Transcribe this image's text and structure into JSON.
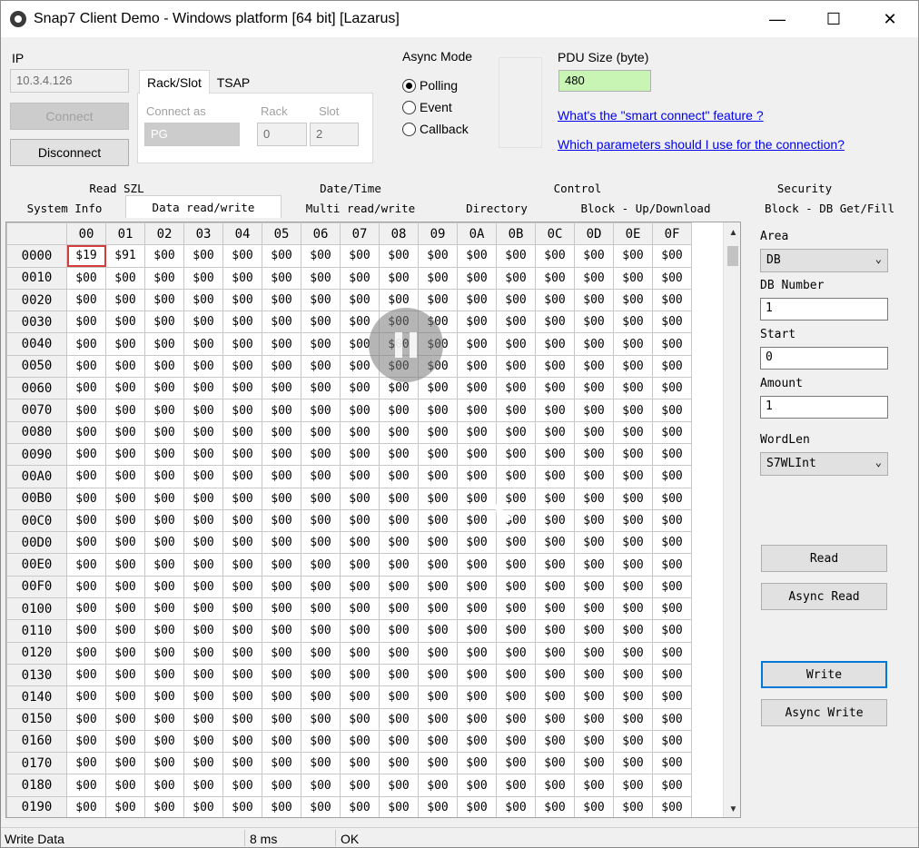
{
  "window": {
    "title": "Snap7 Client Demo - Windows platform [64 bit] [Lazarus]",
    "minimize": "—",
    "maximize": "☐",
    "close": "✕"
  },
  "connection": {
    "ip_label": "IP",
    "ip_value": "10.3.4.126",
    "connect_label": "Connect",
    "disconnect_label": "Disconnect",
    "tab_rack_slot": "Rack/Slot",
    "tab_tsap": "TSAP",
    "connect_as_label": "Connect as",
    "connect_as_value": "PG",
    "rack_label": "Rack",
    "rack_value": "0",
    "slot_label": "Slot",
    "slot_value": "2"
  },
  "async": {
    "label": "Async Mode",
    "options": [
      {
        "label": "Polling",
        "checked": true
      },
      {
        "label": "Event",
        "checked": false
      },
      {
        "label": "Callback",
        "checked": false
      }
    ]
  },
  "pdu": {
    "label": "PDU Size (byte)",
    "value": "480",
    "link1": "What's the \"smart connect\" feature ?",
    "link2": "Which parameters should I use for the connection?"
  },
  "tabs_top": [
    "Read SZL",
    "Date/Time",
    "Control",
    "Security"
  ],
  "tabs_bottom": [
    "System Info",
    "Data read/write",
    "Multi read/write",
    "Directory",
    "Block - Up/Download",
    "Block - DB Get/Fill"
  ],
  "active_tab": "Data read/write",
  "grid": {
    "columns": [
      "00",
      "01",
      "02",
      "03",
      "04",
      "05",
      "06",
      "07",
      "08",
      "09",
      "0A",
      "0B",
      "0C",
      "0D",
      "0E",
      "0F"
    ],
    "rows": [
      "0000",
      "0010",
      "0020",
      "0030",
      "0040",
      "0050",
      "0060",
      "0070",
      "0080",
      "0090",
      "00A0",
      "00B0",
      "00C0",
      "00D0",
      "00E0",
      "00F0",
      "0100",
      "0110",
      "0120",
      "0130",
      "0140",
      "0150",
      "0160",
      "0170",
      "0180",
      "0190"
    ],
    "default_value": "$00",
    "first_row_values": [
      "$19",
      "$91",
      "$00",
      "$00",
      "$00",
      "$00",
      "$00",
      "$00",
      "$00",
      "$00",
      "$00",
      "$00",
      "$00",
      "$00",
      "$00",
      "$00"
    ],
    "other_values": "$00",
    "selected_cell": "0000:00"
  },
  "right_panel": {
    "area_label": "Area",
    "area_value": "DB",
    "db_number_label": "DB Number",
    "db_number_value": "1",
    "start_label": "Start",
    "start_value": "0",
    "amount_label": "Amount",
    "amount_value": "1",
    "wordlen_label": "WordLen",
    "wordlen_value": "S7WLInt",
    "read_label": "Read",
    "async_read_label": "Async Read",
    "write_label": "Write",
    "async_write_label": "Async Write"
  },
  "status": {
    "message": "Write Data",
    "time": "8 ms",
    "result": "OK"
  },
  "colors": {
    "pdu_bg": "#c8f5b4",
    "link": "#0000ee",
    "selected_cell_border": "#d23c3c",
    "focus_border": "#0078d7"
  }
}
